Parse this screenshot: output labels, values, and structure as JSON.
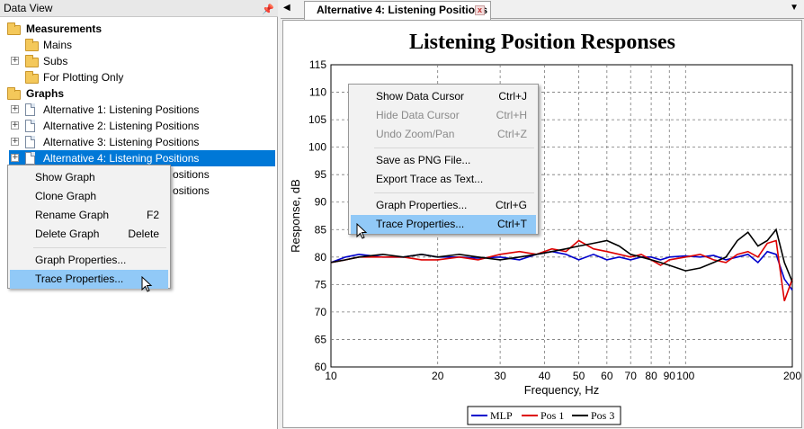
{
  "left_panel": {
    "title": "Data View",
    "pin_icon": "pin-icon",
    "tree": [
      {
        "label": "Measurements",
        "bold": true,
        "icon": "folder-icon",
        "expander": "",
        "level": 0
      },
      {
        "label": "Mains",
        "bold": false,
        "icon": "folder-icon",
        "expander": "",
        "level": 1
      },
      {
        "label": "Subs",
        "bold": false,
        "icon": "folder-icon",
        "expander": "+",
        "level": 1
      },
      {
        "label": "For Plotting Only",
        "bold": false,
        "icon": "folder-icon",
        "expander": "",
        "level": 1
      },
      {
        "label": "Graphs",
        "bold": true,
        "icon": "folder-icon",
        "expander": "",
        "level": 0
      },
      {
        "label": "Alternative 1: Listening Positions",
        "bold": false,
        "icon": "doc-icon",
        "expander": "+",
        "level": 1
      },
      {
        "label": "Alternative 2: Listening Positions",
        "bold": false,
        "icon": "doc-icon",
        "expander": "+",
        "level": 1
      },
      {
        "label": "Alternative 3: Listening Positions",
        "bold": false,
        "icon": "doc-icon",
        "expander": "+",
        "level": 1
      },
      {
        "label": "Alternative 4: Listening Positions",
        "bold": false,
        "icon": "doc-icon",
        "expander": "+",
        "level": 1,
        "selected": true
      },
      {
        "label": "ositions",
        "bold": false,
        "icon": "",
        "expander": "",
        "level": 1,
        "partial": true
      },
      {
        "label": "ositions",
        "bold": false,
        "icon": "",
        "expander": "",
        "level": 1,
        "partial": true
      }
    ],
    "context_menu": [
      {
        "label": "Show Graph",
        "shortcut": ""
      },
      {
        "label": "Clone Graph",
        "shortcut": ""
      },
      {
        "label": "Rename Graph",
        "shortcut": "F2"
      },
      {
        "label": "Delete Graph",
        "shortcut": "Delete"
      },
      {
        "separator": true
      },
      {
        "label": "Graph Properties...",
        "shortcut": ""
      },
      {
        "label": "Trace Properties...",
        "shortcut": "",
        "hover": true
      }
    ]
  },
  "right_panel": {
    "tab_label": "Alternative 4: Listening Positions",
    "tab_close": "x",
    "nav_left": "◀",
    "nav_right": "▼",
    "graph_context_menu": [
      {
        "label": "Show Data Cursor",
        "shortcut": "Ctrl+J",
        "disabled": false
      },
      {
        "label": "Hide Data Cursor",
        "shortcut": "Ctrl+H",
        "disabled": true
      },
      {
        "label": "Undo Zoom/Pan",
        "shortcut": "Ctrl+Z",
        "disabled": true
      },
      {
        "separator": true
      },
      {
        "label": "Save as PNG File...",
        "shortcut": "",
        "disabled": false
      },
      {
        "label": "Export Trace as Text...",
        "shortcut": "",
        "disabled": false
      },
      {
        "separator": true
      },
      {
        "label": "Graph Properties...",
        "shortcut": "Ctrl+G",
        "disabled": false
      },
      {
        "label": "Trace Properties...",
        "shortcut": "Ctrl+T",
        "disabled": false,
        "hover": true
      }
    ]
  },
  "colors": {
    "selection": "#0078d7",
    "menu_hover": "#91c9f7",
    "series_mlp": "#0000cc",
    "series_pos1": "#dd0000",
    "series_pos3": "#000000"
  },
  "chart_data": {
    "type": "line",
    "title": "Listening Position Responses",
    "xlabel": "Frequency, Hz",
    "ylabel": "Response, dB",
    "xscale": "log",
    "xlim": [
      10,
      200
    ],
    "ylim": [
      60,
      115
    ],
    "xticks": [
      10,
      20,
      30,
      40,
      50,
      60,
      70,
      80,
      90,
      100,
      200
    ],
    "xtick_labels": [
      "10",
      "20",
      "30",
      "40",
      "50",
      "60",
      "70",
      "80",
      "90",
      "100",
      "200"
    ],
    "yticks": [
      60,
      65,
      70,
      75,
      80,
      85,
      90,
      95,
      100,
      105,
      110,
      115
    ],
    "ytick_labels": [
      "60",
      "65",
      "70",
      "75",
      "80",
      "85",
      "90",
      "95",
      "100",
      "105",
      "110",
      "115"
    ],
    "grid": true,
    "legend_position": "bottom",
    "series": [
      {
        "name": "MLP",
        "color": "#0000cc",
        "x": [
          10,
          11,
          12,
          14,
          16,
          18,
          20,
          23,
          26,
          30,
          34,
          38,
          42,
          46,
          50,
          55,
          60,
          65,
          70,
          75,
          80,
          85,
          90,
          100,
          110,
          120,
          130,
          140,
          150,
          160,
          170,
          180,
          190,
          200
        ],
        "y": [
          79,
          80,
          80.5,
          80,
          80,
          80.5,
          80,
          80,
          79.8,
          80,
          79.5,
          80.5,
          81,
          80.5,
          79.5,
          80.5,
          79.5,
          80,
          79.5,
          80,
          80,
          79.5,
          80,
          80.2,
          80,
          80.3,
          79.5,
          80,
          80.5,
          79,
          81,
          80.5,
          76,
          74
        ]
      },
      {
        "name": "Pos 1",
        "color": "#dd0000",
        "x": [
          10,
          11,
          12,
          14,
          16,
          18,
          20,
          23,
          26,
          30,
          34,
          38,
          42,
          46,
          50,
          55,
          60,
          65,
          70,
          75,
          80,
          85,
          90,
          100,
          110,
          120,
          130,
          140,
          150,
          160,
          170,
          180,
          190,
          200
        ],
        "y": [
          79,
          79.5,
          80,
          80,
          80,
          79.5,
          79.5,
          80,
          79.5,
          80.5,
          81,
          80.5,
          81.5,
          81,
          83,
          81.5,
          81,
          80.5,
          80,
          80.5,
          79.5,
          78.5,
          79.5,
          80,
          80.5,
          79.5,
          79,
          80.5,
          81,
          80,
          82.5,
          83,
          72,
          76
        ]
      },
      {
        "name": "Pos 3",
        "color": "#000000",
        "x": [
          10,
          11,
          12,
          14,
          16,
          18,
          20,
          23,
          26,
          30,
          34,
          38,
          42,
          46,
          50,
          55,
          60,
          65,
          70,
          75,
          80,
          85,
          90,
          100,
          110,
          120,
          130,
          140,
          150,
          160,
          170,
          180,
          190,
          200
        ],
        "y": [
          79,
          79.5,
          80,
          80.5,
          80,
          80.5,
          80,
          80.5,
          80,
          79.5,
          80,
          80.5,
          81,
          81.5,
          82,
          82.5,
          83,
          82,
          80.5,
          80,
          79.5,
          79,
          78.5,
          77.5,
          78,
          79,
          80,
          83,
          84.5,
          82,
          83,
          85,
          79,
          75.5
        ]
      }
    ]
  }
}
